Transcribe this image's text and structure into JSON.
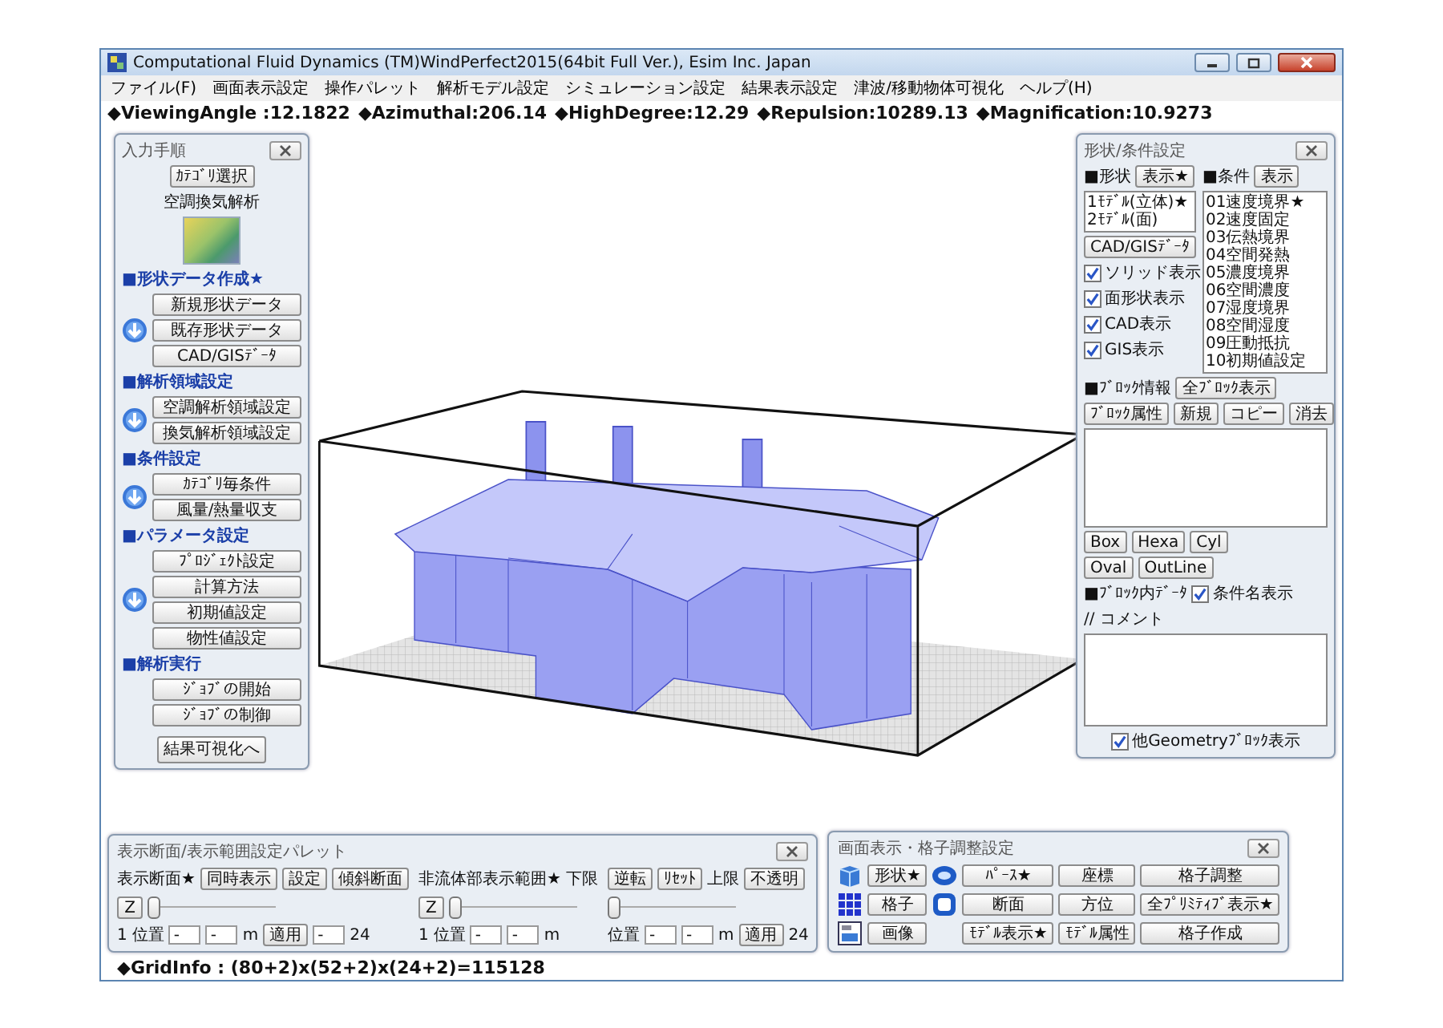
{
  "window": {
    "title": "Computational Fluid Dynamics (TM)WindPerfect2015(64bit Full Ver.), Esim Inc. Japan"
  },
  "menu": [
    "ファイル(F)",
    "画面表示設定",
    "操作パレット",
    "解析モデル設定",
    "シミュレーション設定",
    "結果表示設定",
    "津波/移動物体可視化",
    "ヘルプ(H)"
  ],
  "info_line": [
    "◆ViewingAngle :12.1822",
    "◆Azimuthal:206.14",
    "◆HighDegree:12.29",
    "◆Repulsion:10289.13",
    "◆Magnification:10.9273"
  ],
  "input_panel": {
    "title": "入力手順",
    "category_button": "ｶﾃｺﾞﾘ選択",
    "category": "空調換気解析",
    "sections": [
      {
        "kind": "step",
        "heading": "■形状データ作成★",
        "buttons": [
          "新規形状データ",
          "既存形状データ",
          "CAD/GISﾃﾞｰﾀ"
        ]
      },
      {
        "kind": "step",
        "heading": "■解析領域設定",
        "buttons": [
          "空調解析領域設定",
          "換気解析領域設定"
        ]
      },
      {
        "kind": "step",
        "heading": "■条件設定",
        "buttons": [
          "ｶﾃｺﾞﾘ毎条件",
          "風量/熱量収支"
        ]
      },
      {
        "kind": "step",
        "heading": "■パラメータ設定",
        "buttons": [
          "ﾌﾟﾛｼﾞｪｸﾄ設定",
          "計算方法",
          "初期値設定",
          "物性値設定"
        ]
      },
      {
        "kind": "plain",
        "heading": "■解析実行",
        "buttons": [
          "ｼﾞｮﾌﾞの開始",
          "ｼﾞｮﾌﾞの制御"
        ]
      }
    ],
    "final_button": "結果可視化へ"
  },
  "shape_panel": {
    "title": "形状/条件設定",
    "shape_label": "■形状",
    "shape_button": "表示★",
    "shapes": [
      "1ﾓﾃﾞﾙ(立体)★",
      "2ﾓﾃﾞﾙ(面)"
    ],
    "cad_button": "CAD/GISﾃﾞｰﾀ",
    "checks": [
      {
        "label": "ソリッド表示",
        "checked": true
      },
      {
        "label": "面形状表示",
        "checked": true
      },
      {
        "label": "CAD表示",
        "checked": true
      },
      {
        "label": "GIS表示",
        "checked": true
      }
    ],
    "condition_label": "■条件",
    "condition_button": "表示",
    "conditions": [
      "01速度境界★",
      "02速度固定",
      "03伝熱境界",
      "04空間発熱",
      "05濃度境界",
      "06空間濃度",
      "07湿度境界",
      "08空間湿度",
      "09圧動抵抗",
      "10初期値設定"
    ],
    "block_label": "■ﾌﾞﾛｯｸ情報",
    "all_blocks_button": "全ﾌﾞﾛｯｸ表示",
    "block_buttons": [
      "ﾌﾞﾛｯｸ属性",
      "新規",
      "コピー",
      "消去"
    ],
    "shape_buttons": [
      [
        "Box",
        "Hexa",
        "Cyl"
      ],
      [
        "Oval",
        "OutLine"
      ]
    ],
    "block_data_label": "■ﾌﾞﾛｯｸ内ﾃﾞｰﾀ",
    "name_check": {
      "label": "条件名表示",
      "checked": true
    },
    "comment_label": "// コメント",
    "other_check": {
      "label": "他Geometryﾌﾞﾛｯｸ表示",
      "checked": true
    }
  },
  "section_panel": {
    "title": "表示断面/表示範囲設定パレット",
    "columns": [
      {
        "header": [
          {
            "kind": "label",
            "text": "表示断面★"
          },
          {
            "kind": "button",
            "text": "同時表示"
          },
          {
            "kind": "button",
            "text": "設定"
          },
          {
            "kind": "button",
            "text": "傾斜断面"
          }
        ],
        "axis_button": "Z",
        "level": 0,
        "footer": [
          {
            "kind": "label",
            "text": "1"
          },
          {
            "kind": "label",
            "text": "位置"
          },
          {
            "kind": "field",
            "text": "-"
          },
          {
            "kind": "field",
            "text": "-"
          },
          {
            "kind": "label",
            "text": "m"
          },
          {
            "kind": "button",
            "text": "適用"
          },
          {
            "kind": "field",
            "text": "-"
          },
          {
            "kind": "label",
            "text": "24"
          }
        ]
      },
      {
        "header": [
          {
            "kind": "label",
            "text": "非流体部表示範囲★"
          },
          {
            "kind": "label",
            "text": "下限"
          }
        ],
        "axis_button": "Z",
        "level": 0,
        "footer": [
          {
            "kind": "label",
            "text": "1"
          },
          {
            "kind": "label",
            "text": "位置"
          },
          {
            "kind": "field",
            "text": "-"
          },
          {
            "kind": "field",
            "text": "-"
          },
          {
            "kind": "label",
            "text": "m"
          }
        ]
      },
      {
        "header": [
          {
            "kind": "button",
            "text": "逆転"
          },
          {
            "kind": "button",
            "text": "ﾘｾｯﾄ"
          },
          {
            "kind": "label",
            "text": "上限"
          },
          {
            "kind": "button",
            "text": "不透明"
          }
        ],
        "level": 0,
        "footer": [
          {
            "kind": "label",
            "text": "位置"
          },
          {
            "kind": "field",
            "text": "-"
          },
          {
            "kind": "field",
            "text": "-"
          },
          {
            "kind": "label",
            "text": "m"
          },
          {
            "kind": "button",
            "text": "適用"
          },
          {
            "kind": "label",
            "text": "24"
          }
        ]
      }
    ]
  },
  "display_panel": {
    "title": "画面表示・格子調整設定",
    "rows": [
      {
        "left_button": "形状★",
        "middle_button": "ﾊﾟｰｽ★",
        "buttons": [
          "座標",
          "格子調整"
        ]
      },
      {
        "left_button": "格子",
        "middle_button": "断面",
        "buttons": [
          "方位",
          "全ﾌﾟﾘﾐﾃｨﾌﾞ表示★"
        ]
      },
      {
        "left_button": "画像",
        "middle_button": "ﾓﾃﾞﾙ表示★",
        "buttons": [
          "ﾓﾃﾞﾙ属性",
          "格子作成"
        ]
      }
    ]
  },
  "status_bar": "◆GridInfo : (80+2)x(52+2)x(24+2)=115128"
}
